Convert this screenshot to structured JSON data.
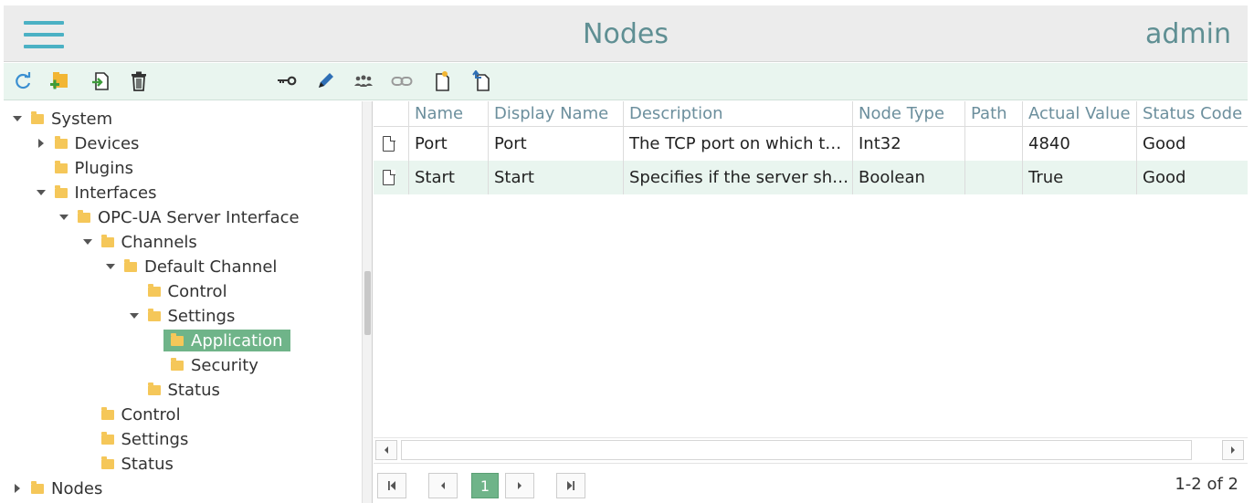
{
  "header": {
    "title": "Nodes",
    "user": "admin"
  },
  "toolbar": {
    "buttons": [
      "refresh-icon",
      "add-folder-icon",
      "import-icon",
      "trash-icon",
      "key-icon",
      "pencil-icon",
      "users-icon",
      "link-icon",
      "new-document-icon",
      "import-document-icon"
    ]
  },
  "tree": {
    "items": [
      {
        "label": "System",
        "state": "expanded",
        "depth": 0
      },
      {
        "label": "Devices",
        "state": "collapsed",
        "depth": 1
      },
      {
        "label": "Plugins",
        "state": "leaf",
        "depth": 1
      },
      {
        "label": "Interfaces",
        "state": "expanded",
        "depth": 1
      },
      {
        "label": "OPC-UA Server Interface",
        "state": "expanded",
        "depth": 2
      },
      {
        "label": "Channels",
        "state": "expanded",
        "depth": 3
      },
      {
        "label": "Default Channel",
        "state": "expanded",
        "depth": 4
      },
      {
        "label": "Control",
        "state": "leaf",
        "depth": 5
      },
      {
        "label": "Settings",
        "state": "expanded",
        "depth": 5
      },
      {
        "label": "Application",
        "state": "leaf",
        "depth": 6,
        "selected": true
      },
      {
        "label": "Security",
        "state": "leaf",
        "depth": 6
      },
      {
        "label": "Status",
        "state": "leaf",
        "depth": 5
      },
      {
        "label": "Control",
        "state": "leaf",
        "depth": 3
      },
      {
        "label": "Settings",
        "state": "leaf",
        "depth": 3
      },
      {
        "label": "Status",
        "state": "leaf",
        "depth": 3
      },
      {
        "label": "Nodes",
        "state": "collapsed",
        "depth": 0
      }
    ]
  },
  "grid": {
    "columns": [
      "Name",
      "Display Name",
      "Description",
      "Node Type",
      "Path",
      "Actual Value",
      "Status Code"
    ],
    "rows": [
      {
        "name": "Port",
        "display_name": "Port",
        "description": "The TCP port on which t…",
        "node_type": "Int32",
        "path": "",
        "actual_value": "4840",
        "status_code": "Good"
      },
      {
        "name": "Start",
        "display_name": "Start",
        "description": "Specifies if the server sh…",
        "node_type": "Boolean",
        "path": "",
        "actual_value": "True",
        "status_code": "Good"
      }
    ]
  },
  "pager": {
    "current_page": "1",
    "info": "1-2 of 2"
  },
  "colors": {
    "accent": "#4bb1c4",
    "title": "#5f8f93",
    "selection": "#6fb489",
    "toolbar_bg": "#e9f5ef",
    "folder": "#f5c759"
  }
}
